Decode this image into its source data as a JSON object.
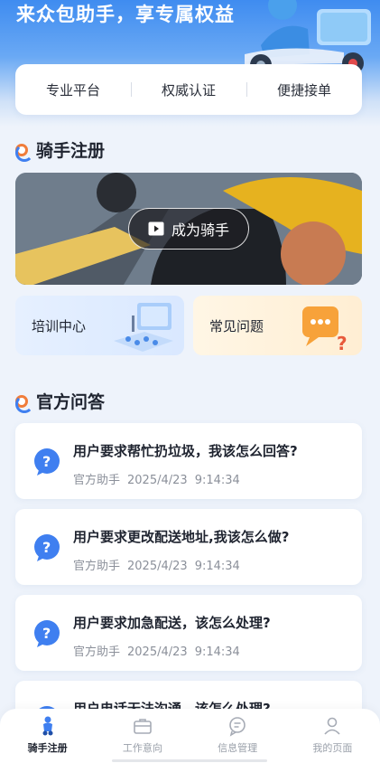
{
  "hero": {
    "title": "来众包助手，享专属权益"
  },
  "features": [
    "专业平台",
    "权威认证",
    "便捷接单"
  ],
  "rider_section": {
    "title": "骑手注册",
    "banner_button": "成为骑手",
    "cards": [
      {
        "label": "培训中心",
        "icon": "training-illustration-icon"
      },
      {
        "label": "常见问题",
        "icon": "chat-question-icon"
      }
    ]
  },
  "qa_section": {
    "title": "官方问答",
    "items": [
      {
        "title": "用户要求帮忙扔垃圾，我该怎么回答?",
        "author": "官方助手",
        "date": "2025/4/23",
        "time": "9:14:34"
      },
      {
        "title": "用户要求更改配送地址,我该怎么做?",
        "author": "官方助手",
        "date": "2025/4/23",
        "time": "9:14:34"
      },
      {
        "title": "用户要求加急配送，该怎么处理?",
        "author": "官方助手",
        "date": "2025/4/23",
        "time": "9:14:34"
      },
      {
        "title": "用户电话无法沟通，该怎么处理?",
        "author": "",
        "date": "",
        "time": ""
      }
    ]
  },
  "tabbar": [
    {
      "label": "骑手注册",
      "icon": "scooter-icon",
      "active": true
    },
    {
      "label": "工作意向",
      "icon": "briefcase-icon",
      "active": false
    },
    {
      "label": "信息管理",
      "icon": "chat-bubble-icon",
      "active": false
    },
    {
      "label": "我的页面",
      "icon": "user-icon",
      "active": false
    }
  ],
  "colors": {
    "accent": "#3f7ff0",
    "accent_orange": "#f07d3b",
    "background": "#eef3fb"
  }
}
